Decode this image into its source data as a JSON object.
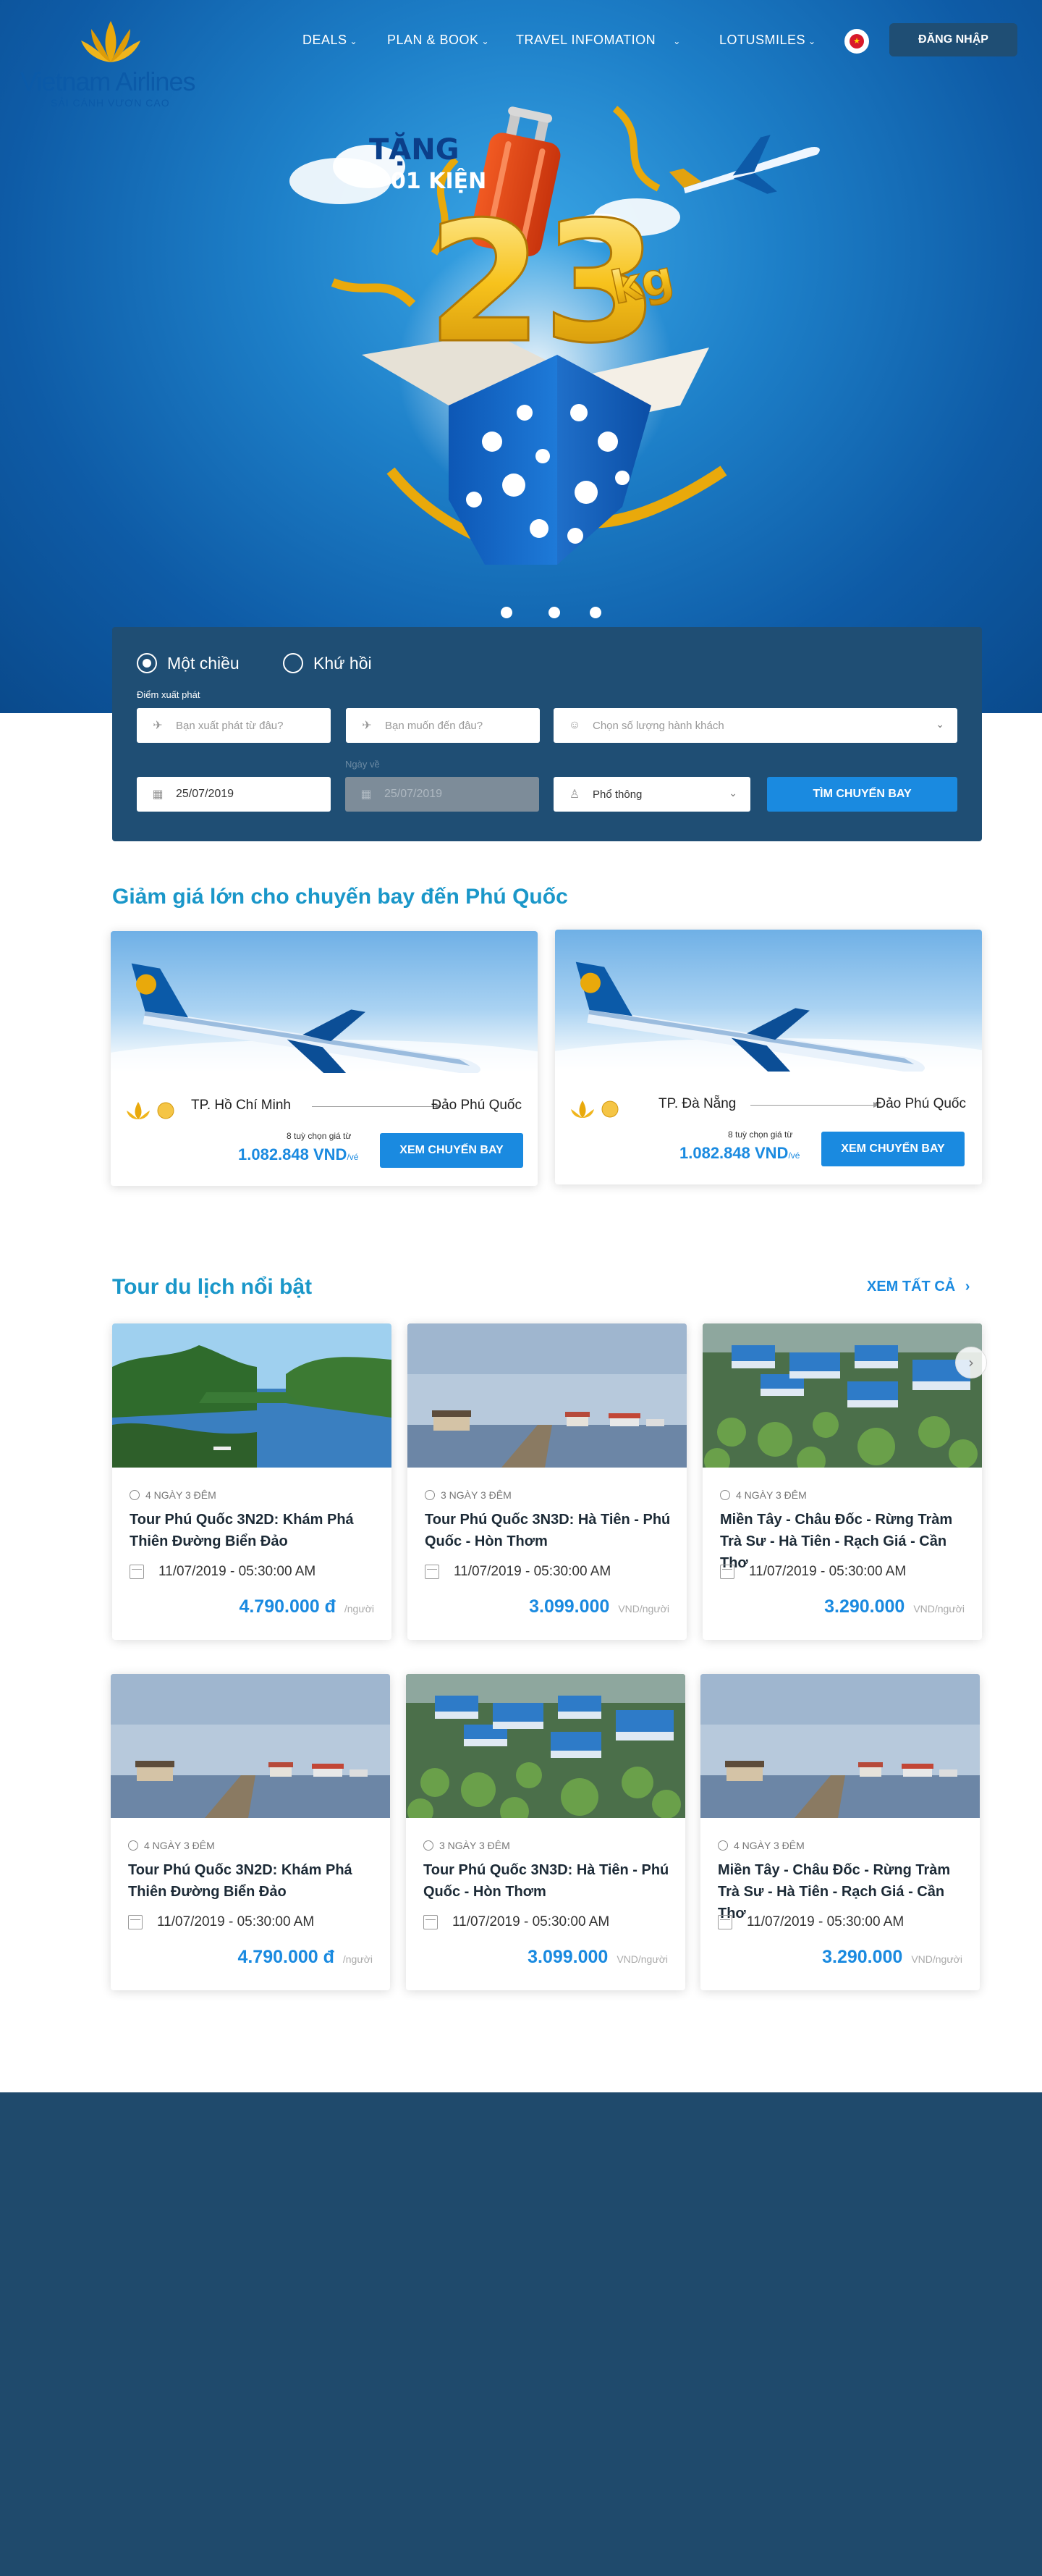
{
  "brand": {
    "name": "Vietnam Airlines",
    "tagline": "SẢI CÁNH VƯƠN CAO"
  },
  "nav": {
    "items": [
      {
        "label": "DEALS"
      },
      {
        "label": "PLAN & BOOK"
      },
      {
        "label": "TRAVEL INFOMATION"
      },
      {
        "label": "LOTUSMILES"
      }
    ],
    "login_label": "ĐĂNG NHẬP",
    "language_icon": "vietnam-flag-icon"
  },
  "hero": {
    "promo_line1": "TẶNG",
    "promo_line2": "01 KIỆN",
    "promo_big": "23",
    "promo_unit": "kg",
    "slides": 3,
    "active_slide": 1
  },
  "search": {
    "trip_types": [
      {
        "label": "Một chiều",
        "selected": true
      },
      {
        "label": "Khứ hồi",
        "selected": false
      }
    ],
    "origin_label": "Điểm xuất phát",
    "origin_placeholder": "Bạn xuất phát từ đâu?",
    "destination_placeholder": "Bạn muốn đến đâu?",
    "passengers_placeholder": "Chọn số lượng hành khách",
    "depart_date": "25/07/2019",
    "return_label": "Ngày về",
    "return_date": "25/07/2019",
    "cabin_class": "Phổ thông",
    "submit_label": "TÌM CHUYẾN BAY"
  },
  "deals": {
    "title": "Giảm giá lớn cho chuyến bay đến Phú Quốc",
    "items": [
      {
        "from": "TP. Hồ Chí Minh",
        "to": "Đảo Phú Quốc",
        "options": "8 tuỳ chọn giá từ",
        "price": "1.082.848 VND",
        "price_unit": "/vé",
        "cta": "XEM CHUYẾN BAY"
      },
      {
        "from": "TP. Đà Nẵng",
        "to": "Đảo Phú Quốc",
        "options": "8 tuỳ chọn giá từ",
        "price": "1.082.848 VND",
        "price_unit": "/vé",
        "cta": "XEM CHUYẾN BAY"
      }
    ]
  },
  "tours": {
    "title": "Tour du lịch nổi bật",
    "view_all": "XEM TẤT CẢ",
    "items": [
      {
        "duration": "4 NGÀY 3 ĐÊM",
        "name": "Tour Phú Quốc 3N2D: Khám Phá Thiên Đường Biển Đảo",
        "date": "11/07/2019 - 05:30:00 AM",
        "price": "4.790.000 đ",
        "unit": "/người",
        "image": "river-island"
      },
      {
        "duration": "3 NGÀY 3 ĐÊM",
        "name": "Tour Phú Quốc 3N3D: Hà Tiên - Phú Quốc - Hòn Thơm",
        "date": "11/07/2019 - 05:30:00 AM",
        "price": "3.099.000",
        "unit": "VND/người",
        "image": "pier"
      },
      {
        "duration": "4 NGÀY 3 ĐÊM",
        "name": "Miền Tây - Châu Đốc - Rừng Tràm Trà Sư - Hà Tiên - Rạch Giá - Cần Thơ",
        "date": "11/07/2019 - 05:30:00 AM",
        "price": "3.290.000",
        "unit": "VND/người",
        "image": "floating-village"
      },
      {
        "duration": "4 NGÀY 3 ĐÊM",
        "name": "Tour Phú Quốc 3N2D: Khám Phá Thiên Đường Biển Đảo",
        "date": "11/07/2019 - 05:30:00 AM",
        "price": "4.790.000 đ",
        "unit": "/người",
        "image": "pier"
      },
      {
        "duration": "3 NGÀY 3 ĐÊM",
        "name": "Tour Phú Quốc 3N3D: Hà Tiên - Phú Quốc - Hòn Thơm",
        "date": "11/07/2019 - 05:30:00 AM",
        "price": "3.099.000",
        "unit": "VND/người",
        "image": "floating-village"
      },
      {
        "duration": "4 NGÀY 3 ĐÊM",
        "name": "Miền Tây - Châu Đốc - Rừng Tràm Trà Sư - Hà Tiên - Rạch Giá - Cần Thơ",
        "date": "11/07/2019 - 05:30:00 AM",
        "price": "3.290.000",
        "unit": "VND/người",
        "image": "pier"
      }
    ]
  },
  "colors": {
    "accent": "#1a8ae0",
    "heading": "#1a97c9",
    "navy": "#1f4e74",
    "footer": "#1f4a6c"
  }
}
